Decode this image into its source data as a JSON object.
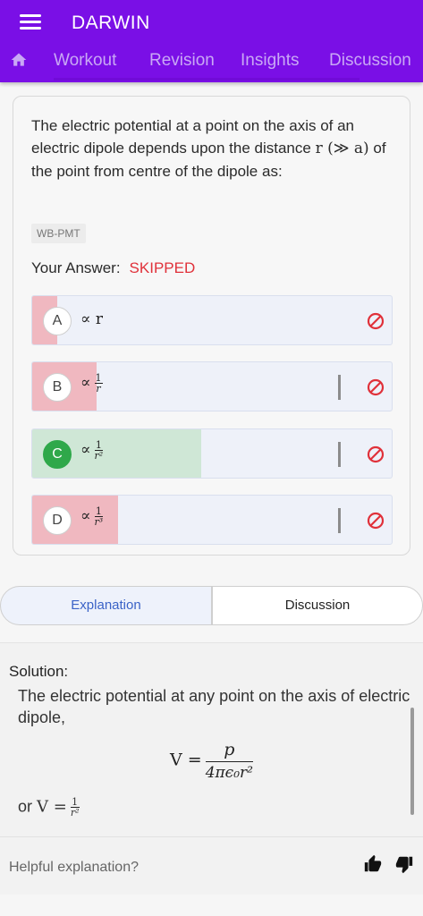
{
  "app": {
    "title": "DARWIN"
  },
  "tabs": [
    "Workout",
    "Revision",
    "Insights",
    "Discussion"
  ],
  "question": {
    "text_before": "The electric potential at a point on the axis of an electric dipole depends upon the distance ",
    "math": "r (≫ a)",
    "text_after": " of the point from centre of the dipole as:",
    "tag": "WB-PMT"
  },
  "answer": {
    "label": "Your Answer:",
    "value": "SKIPPED"
  },
  "options": [
    {
      "letter": "A",
      "prefix": "∝",
      "expr": "r",
      "num": "",
      "den": "",
      "fill_fraction": 0.07,
      "correct": false
    },
    {
      "letter": "B",
      "prefix": "∝",
      "expr": "",
      "num": "1",
      "den": "r",
      "fill_fraction": 0.18,
      "correct": false
    },
    {
      "letter": "C",
      "prefix": "∝",
      "expr": "",
      "num": "1",
      "den": "r²",
      "fill_fraction": 0.47,
      "correct": true
    },
    {
      "letter": "D",
      "prefix": "∝",
      "expr": "",
      "num": "1",
      "den": "r³",
      "fill_fraction": 0.24,
      "correct": false
    }
  ],
  "toggle": {
    "explanation": "Explanation",
    "discussion": "Discussion"
  },
  "solution": {
    "title": "Solution:",
    "text": "The electric potential at any point on the axis of electric dipole,",
    "formula_lhs": "V =",
    "formula_num": "p",
    "formula_den": "4πϵ₀r²",
    "or_text": "or",
    "or_lhs": "V =",
    "or_num": "1",
    "or_den": "r²"
  },
  "feedback": {
    "label": "Helpful explanation?"
  },
  "colors": {
    "header": "#7a0fe6",
    "skipped": "#e0313a",
    "correct": "#2fa84a",
    "wrong_fill": "#f0b8c0",
    "correct_fill": "#cfe7d6"
  }
}
